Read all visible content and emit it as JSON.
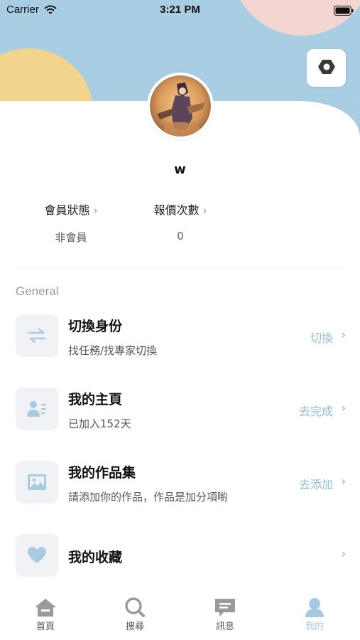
{
  "status_bar": {
    "carrier": "Carrier",
    "time": "3:21 PM"
  },
  "colors": {
    "header_blue": "#a9cde3",
    "accent_yellow": "#f2d48c",
    "accent_pink": "#f3d6d2",
    "active_tab": "#a9c9e3",
    "action_text": "#8fbcd6"
  },
  "profile": {
    "username": "w"
  },
  "stats": {
    "member_status": {
      "label": "會員狀態",
      "value": "非會員"
    },
    "quote_count": {
      "label": "報價次數",
      "value": "0"
    }
  },
  "section": {
    "title": "General"
  },
  "menu": [
    {
      "icon": "swap-icon",
      "title": "切換身份",
      "subtitle": "找任務/找專家切換",
      "action": "切換"
    },
    {
      "icon": "profile-card-icon",
      "title": "我的主頁",
      "subtitle": "已加入152天",
      "action": "去完成"
    },
    {
      "icon": "image-icon",
      "title": "我的作品集",
      "subtitle": "請添加你的作品，作品是加分項喲",
      "action": "去添加"
    },
    {
      "icon": "heart-icon",
      "title": "我的收藏",
      "subtitle": "",
      "action": ""
    }
  ],
  "tabs": [
    {
      "icon": "home-icon",
      "label": "首頁",
      "active": false
    },
    {
      "icon": "search-icon",
      "label": "搜尋",
      "active": false
    },
    {
      "icon": "message-icon",
      "label": "訊息",
      "active": false
    },
    {
      "icon": "user-icon",
      "label": "我的",
      "active": true
    }
  ]
}
